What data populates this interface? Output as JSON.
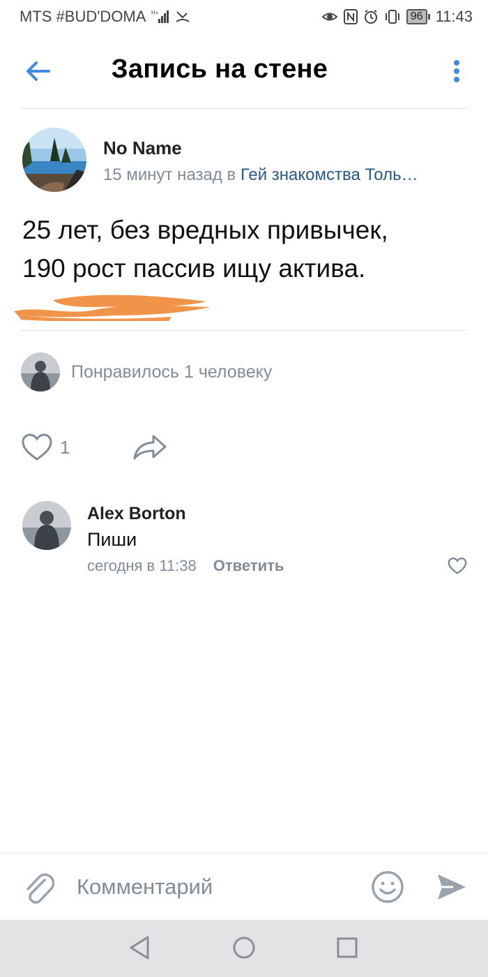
{
  "status_bar": {
    "carrier": "MTS #BUD'DOMA",
    "battery": "96",
    "time": "11:43"
  },
  "header": {
    "title": "Запись на стене",
    "back_icon": "arrow-left-icon",
    "menu_icon": "more-vertical-icon",
    "accent_color": "#3f8ae0"
  },
  "post": {
    "author": "No Name",
    "time_prefix": "15 минут назад в",
    "group": "Гей знакомства Толь…",
    "text_line1": "25 лет, без вредных привычек,",
    "text_line2": "190 рост пассив ищу актива.",
    "redaction_color": "#f0a04b"
  },
  "likes": {
    "summary": "Понравилось 1 человеку"
  },
  "actions": {
    "like_count": "1",
    "like_icon": "heart-outline-icon",
    "share_icon": "share-icon"
  },
  "comment": {
    "author": "Alex Borton",
    "text": "Пиши",
    "time": "сегодня в 11:38",
    "reply_label": "Ответить"
  },
  "composer": {
    "placeholder": "Комментарий",
    "attach_icon": "paperclip-icon",
    "emoji_icon": "smile-icon",
    "send_icon": "send-icon"
  },
  "navigation": {
    "back_icon": "triangle-back-icon",
    "home_icon": "circle-home-icon",
    "recents_icon": "square-recents-icon"
  }
}
